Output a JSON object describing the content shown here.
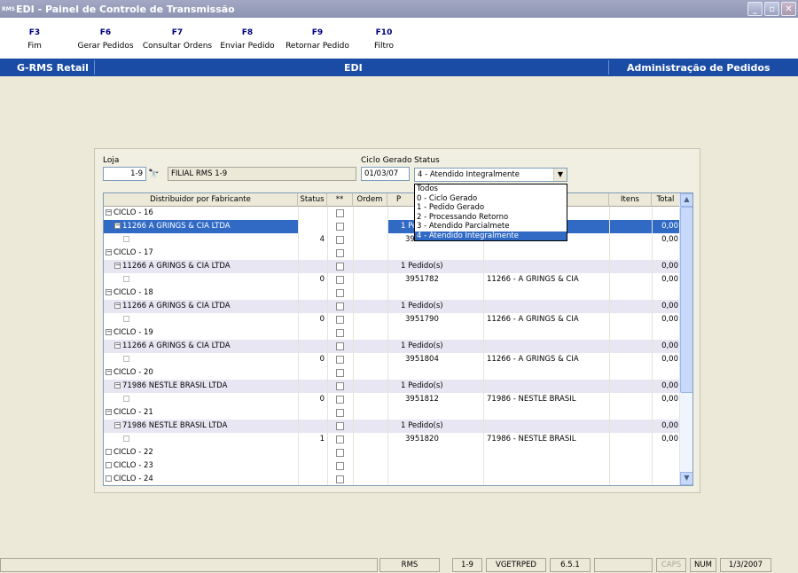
{
  "window": {
    "title": "EDI - Painel de Controle de Transmissão",
    "logo": "RMS"
  },
  "fkeys": [
    {
      "key": "F3",
      "label": "Fim"
    },
    {
      "key": "F6",
      "label": "Gerar Pedidos"
    },
    {
      "key": "F7",
      "label": "Consultar Ordens"
    },
    {
      "key": "F8",
      "label": "Enviar Pedido"
    },
    {
      "key": "F9",
      "label": "Retornar Pedido"
    },
    {
      "key": "F10",
      "label": "Filtro"
    }
  ],
  "navbar": {
    "left": "G-RMS Retail",
    "center": "EDI",
    "right": "Administração de Pedidos"
  },
  "form": {
    "loja_label": "Loja",
    "loja_value": "1-9",
    "loja_desc": "FILIAL RMS 1-9",
    "ciclo_label": "Ciclo Gerado",
    "ciclo_value": "01/03/07",
    "status_label": "Status",
    "status_value": "4 - Atendido Integralmente"
  },
  "status_options": [
    "Todos",
    "0 - Ciclo Gerado",
    "1 - Pedido Gerado",
    "2 - Processando Retorno",
    "3 - Atendido Parcialmete",
    "4 - Atendido Integralmente"
  ],
  "grid": {
    "headers": [
      "Distribuidor por Fabricante",
      "Status",
      "**",
      "Ordem",
      "P",
      "Itens",
      "Total"
    ],
    "rows": [
      {
        "level": 0,
        "text": "CICLO - 16",
        "status": "",
        "pedido": "",
        "forn": "",
        "total": ""
      },
      {
        "level": 1,
        "text": "11266 A GRINGS & CIA LTDA",
        "status": "",
        "pedido": "1 Pe",
        "forn": "",
        "total": "0,00",
        "sel": true
      },
      {
        "level": 2,
        "text": "",
        "status": "4",
        "pedido": "39",
        "forn": "CIA",
        "total": "0,00"
      },
      {
        "level": 0,
        "text": "CICLO - 17",
        "status": "",
        "pedido": "",
        "forn": "",
        "total": ""
      },
      {
        "level": 1,
        "text": "11266 A GRINGS & CIA LTDA",
        "status": "",
        "pedido": "1 Pedido(s)",
        "forn": "",
        "total": "0,00"
      },
      {
        "level": 2,
        "text": "",
        "status": "0",
        "pedido": "3951782",
        "forn": "11266 - A GRINGS & CIA",
        "total": "0,00"
      },
      {
        "level": 0,
        "text": "CICLO - 18",
        "status": "",
        "pedido": "",
        "forn": "",
        "total": ""
      },
      {
        "level": 1,
        "text": "11266 A GRINGS & CIA LTDA",
        "status": "",
        "pedido": "1 Pedido(s)",
        "forn": "",
        "total": "0,00"
      },
      {
        "level": 2,
        "text": "",
        "status": "0",
        "pedido": "3951790",
        "forn": "11266 - A GRINGS & CIA",
        "total": "0,00"
      },
      {
        "level": 0,
        "text": "CICLO - 19",
        "status": "",
        "pedido": "",
        "forn": "",
        "total": ""
      },
      {
        "level": 1,
        "text": "11266 A GRINGS & CIA LTDA",
        "status": "",
        "pedido": "1 Pedido(s)",
        "forn": "",
        "total": "0,00"
      },
      {
        "level": 2,
        "text": "",
        "status": "0",
        "pedido": "3951804",
        "forn": "11266 - A GRINGS & CIA",
        "total": "0,00"
      },
      {
        "level": 0,
        "text": "CICLO - 20",
        "status": "",
        "pedido": "",
        "forn": "",
        "total": ""
      },
      {
        "level": 1,
        "text": "71986 NESTLE BRASIL LTDA",
        "status": "",
        "pedido": "1 Pedido(s)",
        "forn": "",
        "total": "0,00"
      },
      {
        "level": 2,
        "text": "",
        "status": "0",
        "pedido": "3951812",
        "forn": "71986 - NESTLE BRASIL",
        "total": "0,00"
      },
      {
        "level": 0,
        "text": "CICLO - 21",
        "status": "",
        "pedido": "",
        "forn": "",
        "total": ""
      },
      {
        "level": 1,
        "text": "71986 NESTLE BRASIL LTDA",
        "status": "",
        "pedido": "1 Pedido(s)",
        "forn": "",
        "total": "0,00"
      },
      {
        "level": 2,
        "text": "",
        "status": "1",
        "pedido": "3951820",
        "forn": "71986 - NESTLE BRASIL",
        "total": "0,00"
      },
      {
        "level": 0,
        "text": "CICLO - 22",
        "status": "",
        "pedido": "",
        "forn": "",
        "total": "",
        "collapsed": true
      },
      {
        "level": 0,
        "text": "CICLO - 23",
        "status": "",
        "pedido": "",
        "forn": "",
        "total": "",
        "collapsed": true
      },
      {
        "level": 0,
        "text": "CICLO - 24",
        "status": "",
        "pedido": "",
        "forn": "",
        "total": "",
        "collapsed": true
      }
    ]
  },
  "statusbar": [
    "RMS",
    "1-9",
    "VGETRPED",
    "6.5.1",
    "",
    "CAPS",
    "NUM",
    "1/3/2007"
  ]
}
